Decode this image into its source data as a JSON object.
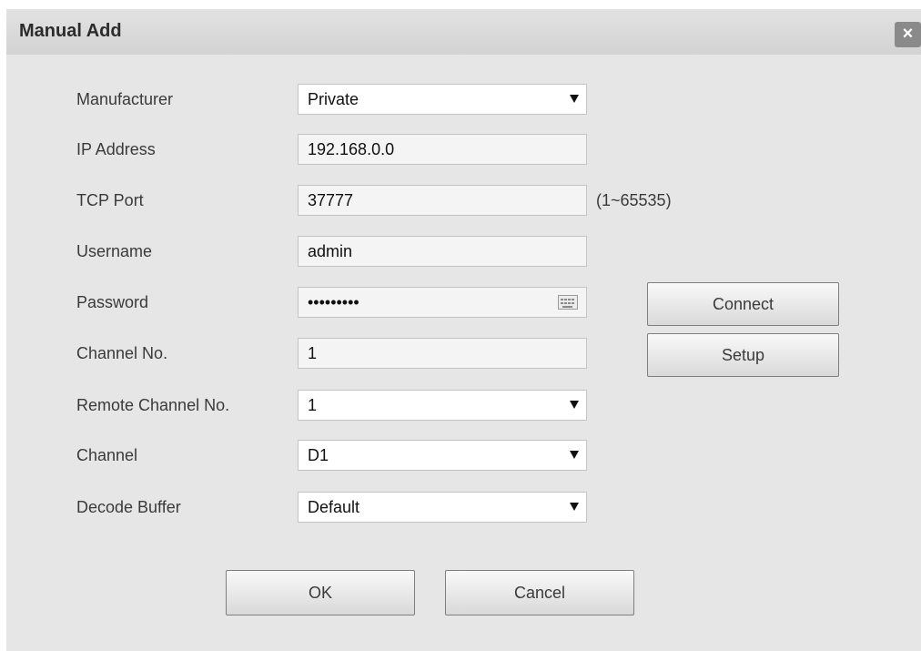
{
  "dialog": {
    "title": "Manual Add",
    "close_label": "×"
  },
  "form": {
    "manufacturer": {
      "label": "Manufacturer",
      "value": "Private"
    },
    "ip_address": {
      "label": "IP Address",
      "value": "192.168.0.0"
    },
    "tcp_port": {
      "label": "TCP Port",
      "value": "37777",
      "hint": "(1~65535)"
    },
    "username": {
      "label": "Username",
      "value": "admin"
    },
    "password": {
      "label": "Password",
      "value": "123456789"
    },
    "channel_no": {
      "label": "Channel No.",
      "value": "1"
    },
    "remote_channel_no": {
      "label": "Remote Channel No.",
      "value": "1"
    },
    "channel": {
      "label": "Channel",
      "value": "D1"
    },
    "decode_buffer": {
      "label": "Decode Buffer",
      "value": "Default"
    }
  },
  "buttons": {
    "connect": "Connect",
    "setup": "Setup",
    "ok": "OK",
    "cancel": "Cancel"
  }
}
